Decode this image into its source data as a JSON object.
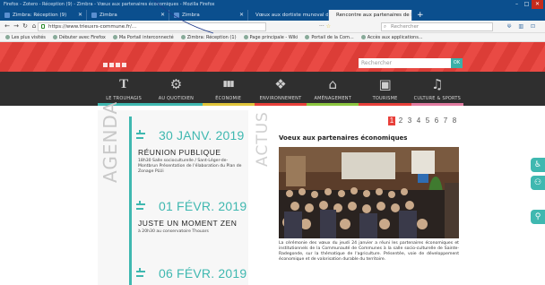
{
  "window": {
    "title": "Firefox - Zotero - Réception (9) - Zimbra - Vœux aux partenaires économiques - Mozilla Firefox"
  },
  "tabs": [
    {
      "label": "Zimbra: Réception (9)",
      "color": "#2f6db3"
    },
    {
      "label": "Zimbra",
      "color": "#2f6db3"
    },
    {
      "label": "Zimbra",
      "color": "#2f6db3"
    },
    {
      "label": "Vœux aux dortiste munoval de-Pro",
      "color": "#e8403a"
    },
    {
      "label": "Rencontre aux partenaires de la Co...",
      "color": "#1a1a1a"
    }
  ],
  "navbar": {
    "back_icon": "arrow-left-icon",
    "url": "https://www.trieuxrs-commune.fr/...",
    "search_placeholder": "Rechercher",
    "right_icons": "⟱ ▥ ⊡"
  },
  "bookmarks": [
    "Les plus visités",
    "Débuter avec Firefox",
    "Ma Portail interconnecté",
    "Zimbra: Réception (1)",
    "Page principale - Wiki",
    "Portail de la Com...",
    "Accès aux applications..."
  ],
  "site": {
    "search_placeholder": "Rechercher",
    "search_button": "OK",
    "menu": [
      {
        "label": "LE TROUHAGIS",
        "glyph": "T",
        "color": "#3fb8b0"
      },
      {
        "label": "AU QUOTIDIEN",
        "glyph": "⚙",
        "color": "#3fb8b0"
      },
      {
        "label": "ÉCONOMIE",
        "glyph": "▮▮▮",
        "color": "#e0c53a"
      },
      {
        "label": "ENVIRONNEMENT",
        "glyph": "❖",
        "color": "#e8403a"
      },
      {
        "label": "AMÉNAGEMENT",
        "glyph": "⌂",
        "color": "#8cc63f"
      },
      {
        "label": "TOURISME",
        "glyph": "▣",
        "color": "#e8403a"
      },
      {
        "label": "CULTURE & SPORTS",
        "glyph": "♫",
        "color": "#e07aa0"
      }
    ],
    "agenda_heading": "AGENDA",
    "actus_heading": "ACTUS",
    "events": [
      {
        "date": "30 JANV. 2019",
        "title": "RÉUNION PUBLIQUE",
        "desc": "18h30 Salle socioculturelle / Sant-Léger-de-Montbrun Présentation de l'élaboration du Plan de Zonage PLUi"
      },
      {
        "date": "01 FÉVR. 2019",
        "title": "JUSTE UN MOMENT ZEN",
        "desc": "à 20h30 au conservatoire Thouars"
      },
      {
        "date": "06 FÉVR. 2019",
        "title": "",
        "desc": ""
      }
    ],
    "pager": [
      "1",
      "2",
      "3",
      "4",
      "5",
      "6",
      "7",
      "8"
    ],
    "pager_active": "1",
    "news_title": "Voeux aux partenaires économiques",
    "news_text": "La cérémonie des vœux du jeudi 24 janvier a réuni les partenaires économiques et institutionnels de la Communauté de Communes à la salle socio-culturelle de Sainte-Radegonde, sur la thématique de l'agriculture. Présentée, voie de développement économique et de valorisation durable du territoire."
  },
  "side_icons": [
    "accessibility-icon",
    "people-icon",
    "location-icon"
  ]
}
